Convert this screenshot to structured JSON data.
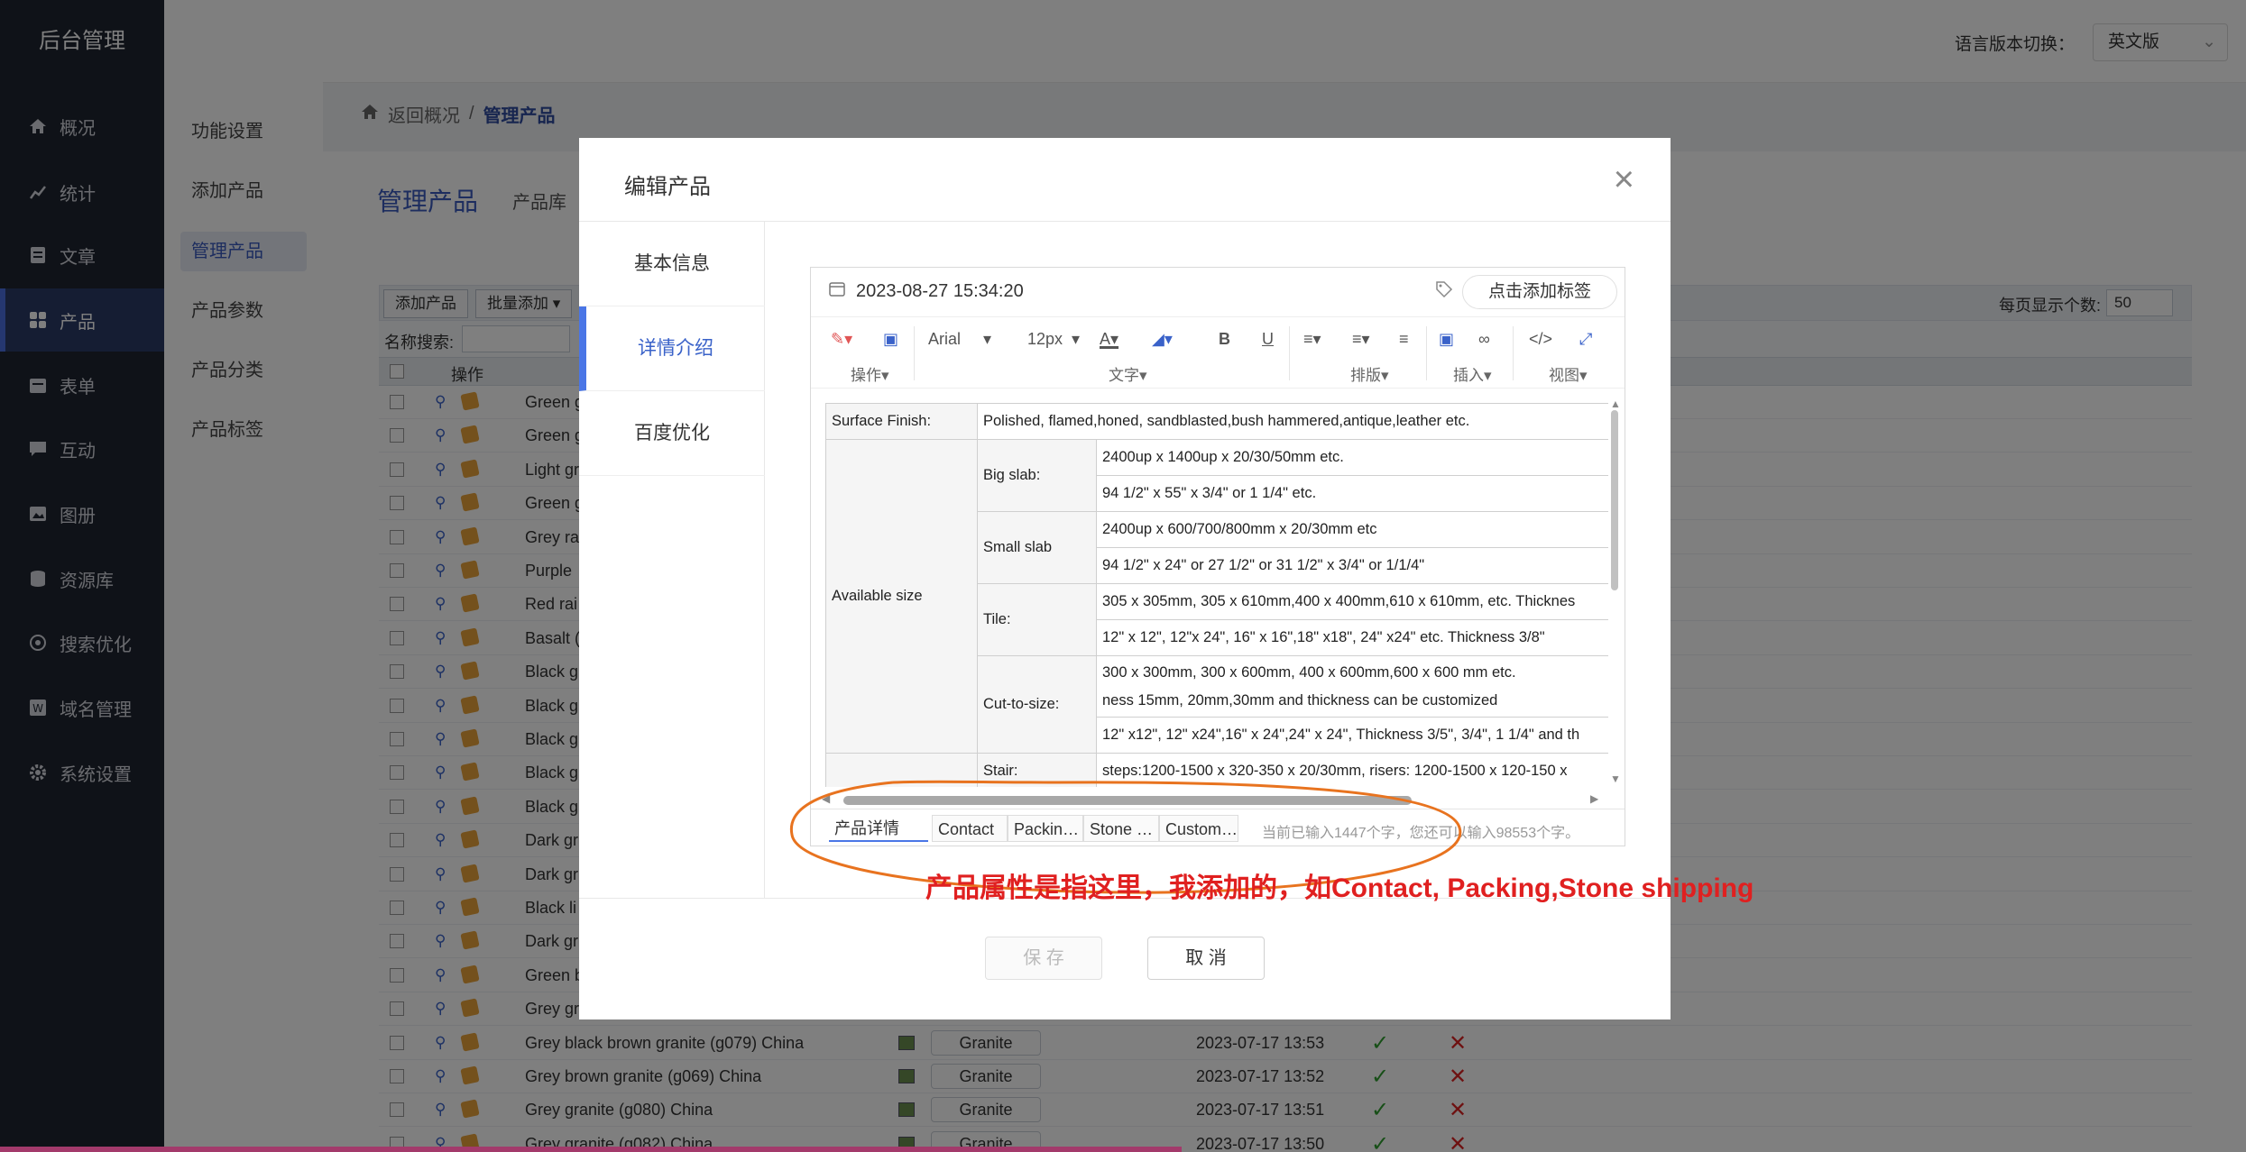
{
  "nav": {
    "brand": "后台管理",
    "items": [
      {
        "label": "概况",
        "icon": "home-icon"
      },
      {
        "label": "统计",
        "icon": "chart-icon"
      },
      {
        "label": "文章",
        "icon": "document-icon"
      },
      {
        "label": "产品",
        "icon": "grid-icon"
      },
      {
        "label": "表单",
        "icon": "calendar-icon"
      },
      {
        "label": "互动",
        "icon": "chat-icon"
      },
      {
        "label": "图册",
        "icon": "album-icon"
      },
      {
        "label": "资源库",
        "icon": "database-icon"
      },
      {
        "label": "搜索优化",
        "icon": "target-icon"
      },
      {
        "label": "域名管理",
        "icon": "domain-icon"
      },
      {
        "label": "系统设置",
        "icon": "gear-icon"
      }
    ]
  },
  "submenu": [
    "功能设置",
    "添加产品",
    "管理产品",
    "产品参数",
    "产品分类",
    "产品标签"
  ],
  "header": {
    "lang_label": "语言版本切换：",
    "lang_value": "英文版"
  },
  "breadcrumb": {
    "back": "返回概况",
    "sep": "/",
    "current": "管理产品"
  },
  "page": {
    "title": "管理产品",
    "tab": "产品库"
  },
  "toolbar": {
    "add": "添加产品",
    "batch": "批量添加",
    "per_page_label": "每页显示个数:",
    "per_page": "50"
  },
  "search": {
    "label": "名称搜索:"
  },
  "table": {
    "op_header": "操作",
    "rows": [
      {
        "name": "Green g"
      },
      {
        "name": "Green g"
      },
      {
        "name": "Light gr"
      },
      {
        "name": "Green g"
      },
      {
        "name": "Grey ra"
      },
      {
        "name": "Purple"
      },
      {
        "name": "Red rai"
      },
      {
        "name": "Basalt ("
      },
      {
        "name": "Black g"
      },
      {
        "name": "Black g"
      },
      {
        "name": "Black g"
      },
      {
        "name": "Black g"
      },
      {
        "name": "Black g"
      },
      {
        "name": "Dark gr"
      },
      {
        "name": "Dark gr"
      },
      {
        "name": "Black li"
      },
      {
        "name": "Dark gr"
      },
      {
        "name": "Green b"
      },
      {
        "name": "Grey gr"
      },
      {
        "name": "Grey black brown granite (g079) China",
        "cat": "Granite",
        "time": "2023-07-17 13:53"
      },
      {
        "name": "Grey brown granite (g069) China",
        "cat": "Granite",
        "time": "2023-07-17 13:52"
      },
      {
        "name": "Grey granite (g080) China",
        "cat": "Granite",
        "time": "2023-07-17 13:51"
      },
      {
        "name": "Grey granite (g082) China",
        "cat": "Granite",
        "time": "2023-07-17 13:50"
      }
    ]
  },
  "modal": {
    "title": "编辑产品",
    "tabs": [
      "基本信息",
      "详情介绍",
      "百度优化"
    ],
    "save": "保 存",
    "cancel": "取 消"
  },
  "editor": {
    "date": "2023-08-27 15:34:20",
    "tag_button": "点击添加标签",
    "toolbar": {
      "font": "Arial",
      "size": "12px",
      "groups": [
        "操作",
        "文字",
        "排版",
        "插入",
        "视图"
      ]
    },
    "content": {
      "surface_label": "Surface Finish:",
      "surface_value": "Polished, flamed,honed, sandblasted,bush hammered,antique,leather etc.",
      "available_label": "Available size",
      "big_slab": "Big slab:",
      "big_slab_1": "2400up x 1400up x 20/30/50mm etc.",
      "big_slab_2": "94 1/2\" x 55\" x 3/4\" or 1 1/4\" etc.",
      "small_slab": "Small slab",
      "small_slab_1": "2400up x 600/700/800mm x 20/30mm etc",
      "small_slab_2": "94 1/2\" x 24\" or 27 1/2\" or 31 1/2\" x 3/4\" or 1/1/4\"",
      "tile": "Tile:",
      "tile_1": "305 x 305mm, 305 x 610mm,400 x 400mm,610 x 610mm,   etc. Thicknes",
      "tile_2": "12\" x 12\", 12\"x 24\", 16\" x 16\",18\" x18\", 24\" x24\" etc. Thickness 3/8\"",
      "cut": "Cut-to-size:",
      "cut_1a": "300 x 300mm, 300 x 600mm, 400 x 600mm,600 x 600 mm etc.",
      "cut_1b": "ness 15mm, 20mm,30mm and thickness can be customized",
      "cut_2": "12\" x12\", 12\" x24\",16\" x 24\",24\" x 24\", Thickness 3/5\", 3/4\", 1 1/4\" and th",
      "stair": "Stair:",
      "stair_1": "steps:1200-1500 x 320-350 x 20/30mm,   risers: 1200-1500 x 120-150 x"
    },
    "tabs": [
      "产品详情",
      "Contact",
      "Packin…",
      "Stone …",
      "Custom…"
    ],
    "count": "当前已输入1447个字，您还可以输入98553个字。"
  },
  "annotation": "产品属性是指这里，我添加的，如Contact, Packing,Stone shipping",
  "colors": {
    "accent": "#3a62c9",
    "annotation": "#e02020",
    "nav_bg": "#1f2430"
  }
}
